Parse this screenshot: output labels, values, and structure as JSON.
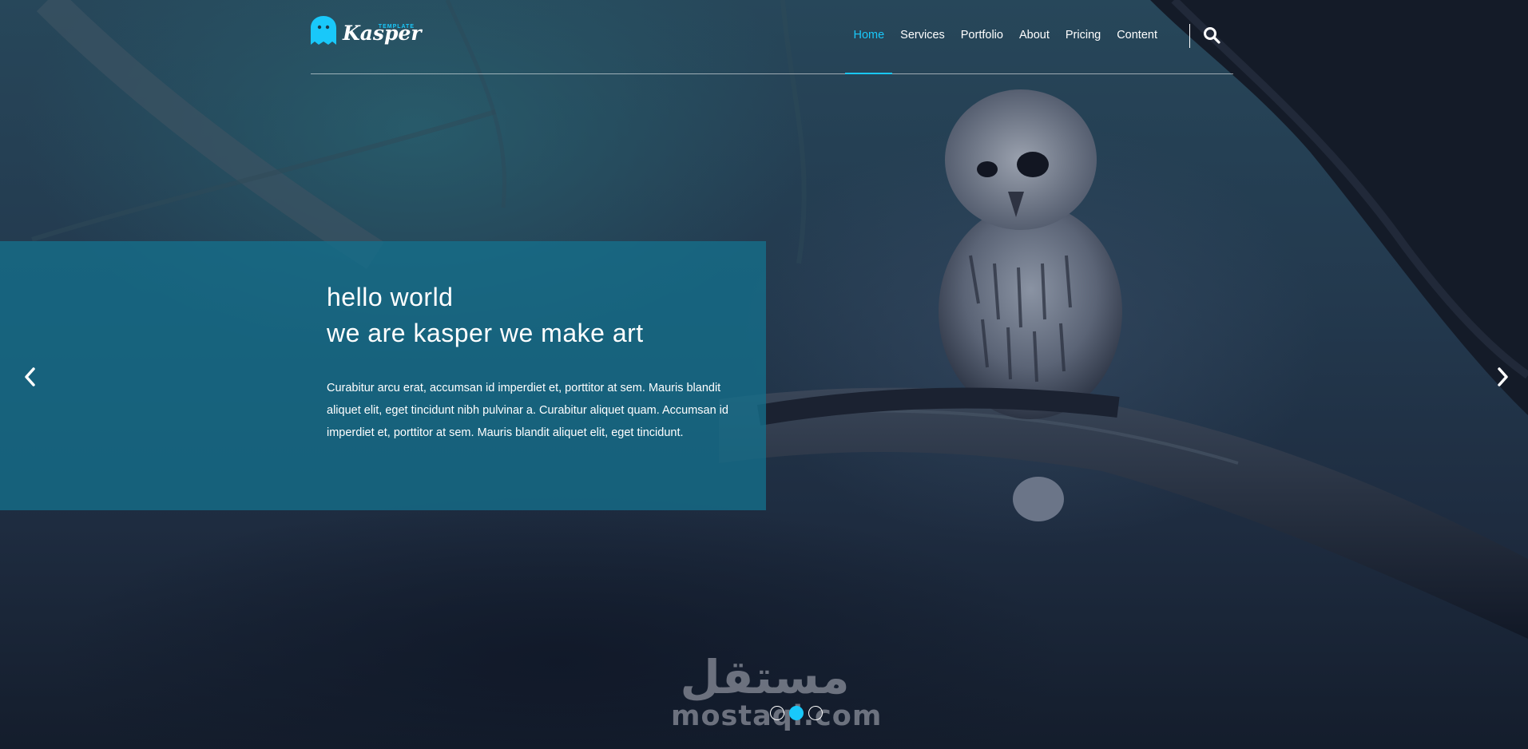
{
  "brand": {
    "name": "Kasper",
    "tagline": "TEMPLATE",
    "logo_icon": "ghost-icon",
    "accent_color": "#19c8fa"
  },
  "nav": {
    "items": [
      {
        "label": "Home",
        "active": true
      },
      {
        "label": "Services",
        "active": false
      },
      {
        "label": "Portfolio",
        "active": false
      },
      {
        "label": "About",
        "active": false
      },
      {
        "label": "Pricing",
        "active": false
      },
      {
        "label": "Content",
        "active": false
      }
    ],
    "search_icon": "search-icon"
  },
  "hero": {
    "title_line1": "hello world",
    "title_line2": "we are kasper we make art",
    "description": "Curabitur arcu erat, accumsan id imperdiet et, porttitor at sem. Mauris blandit aliquet elit, eget tincidunt nibh pulvinar a. Curabitur aliquet quam. Accumsan id imperdiet et, porttitor at sem. Mauris blandit aliquet elit, eget tincidunt.",
    "prev_icon": "chevron-left-icon",
    "next_icon": "chevron-right-icon",
    "slides_total": 3,
    "active_slide": 2
  },
  "watermark": {
    "arabic": "مستقل",
    "latin": "mostaql.com"
  }
}
